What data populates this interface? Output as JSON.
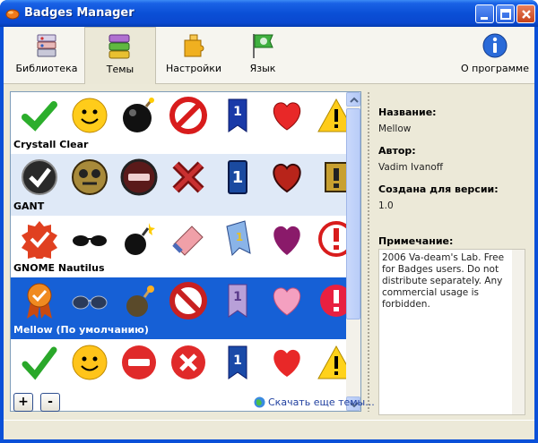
{
  "window": {
    "title": "Badges Manager"
  },
  "toolbar": {
    "tabs": [
      {
        "label": "Библиотека",
        "icon": "library-icon"
      },
      {
        "label": "Темы",
        "icon": "themes-icon"
      },
      {
        "label": "Настройки",
        "icon": "settings-puzzle-icon"
      },
      {
        "label": "Язык",
        "icon": "language-flag-icon"
      },
      {
        "label": "О программе",
        "icon": "info-icon"
      }
    ],
    "active_tab": "Темы"
  },
  "themes": [
    {
      "name": "Crystall Clear",
      "selected": false
    },
    {
      "name": "GANT",
      "selected": false
    },
    {
      "name": "GNOME Nautilus",
      "selected": false
    },
    {
      "name": "Mellow (По умолчанию)",
      "selected": true
    },
    {
      "name": "",
      "selected": false
    }
  ],
  "buttons": {
    "add": "+",
    "remove": "-"
  },
  "download_link": "Скачать еще темы...",
  "details": {
    "name_label": "Название:",
    "name_value": "Mellow",
    "author_label": "Автор:",
    "author_value": "Vadim Ivanoff",
    "version_label": "Создана для версии:",
    "version_value": "1.0",
    "note_label": "Примечание:",
    "note_value": "2006 Va-deam's Lab. Free for Badges users. Do not distribute separately. Any commercial usage is forbidden."
  }
}
